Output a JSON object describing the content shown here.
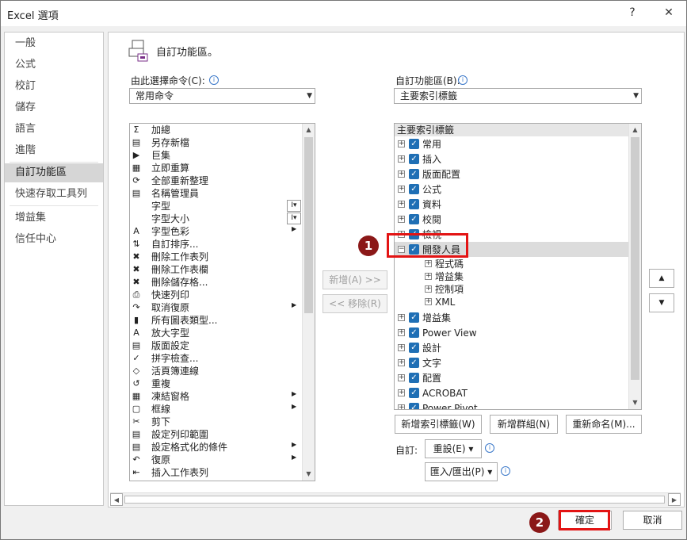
{
  "window": {
    "title": "Excel 選項",
    "help": "?",
    "close": "✕"
  },
  "nav": [
    {
      "label": "一般"
    },
    {
      "label": "公式"
    },
    {
      "label": "校訂"
    },
    {
      "label": "儲存"
    },
    {
      "label": "語言"
    },
    {
      "label": "進階"
    },
    {
      "label": "自訂功能區"
    },
    {
      "label": "快速存取工具列"
    },
    {
      "label": "增益集"
    },
    {
      "label": "信任中心"
    }
  ],
  "header": {
    "title": "自訂功能區。"
  },
  "left": {
    "label": "由此選擇命令(C):",
    "combo_value": "常用命令",
    "commands": [
      {
        "label": "加總",
        "icon": "Σ"
      },
      {
        "label": "另存新檔",
        "icon": "▤"
      },
      {
        "label": "巨集",
        "icon": "▶"
      },
      {
        "label": "立即重算",
        "icon": "▦"
      },
      {
        "label": "全部重新整理",
        "icon": "⟳"
      },
      {
        "label": "名稱管理員",
        "icon": "▤"
      },
      {
        "label": "字型",
        "icon": ""
      },
      {
        "label": "字型大小",
        "icon": ""
      },
      {
        "label": "字型色彩",
        "icon": "A"
      },
      {
        "label": "自訂排序...",
        "icon": "⇅"
      },
      {
        "label": "刪除工作表列",
        "icon": "✖"
      },
      {
        "label": "刪除工作表欄",
        "icon": "✖"
      },
      {
        "label": "刪除儲存格...",
        "icon": "✖"
      },
      {
        "label": "快速列印",
        "icon": "⎙"
      },
      {
        "label": "取消復原",
        "icon": "↷"
      },
      {
        "label": "所有圖表類型...",
        "icon": "▮"
      },
      {
        "label": "放大字型",
        "icon": "A"
      },
      {
        "label": "版面設定",
        "icon": "▤"
      },
      {
        "label": "拼字檢查...",
        "icon": "✓"
      },
      {
        "label": "活頁簿連線",
        "icon": "◇"
      },
      {
        "label": "重複",
        "icon": "↺"
      },
      {
        "label": "凍結窗格",
        "icon": "▦"
      },
      {
        "label": "框線",
        "icon": "▢"
      },
      {
        "label": "剪下",
        "icon": "✂"
      },
      {
        "label": "設定列印範圍",
        "icon": "▤"
      },
      {
        "label": "設定格式化的條件",
        "icon": "▤"
      },
      {
        "label": "復原",
        "icon": "↶"
      },
      {
        "label": "插入工作表列",
        "icon": "⇤"
      }
    ]
  },
  "mid": {
    "add": "新增(A) >>",
    "remove": "<< 移除(R)"
  },
  "right": {
    "label": "自訂功能區(B):",
    "combo_value": "主要索引標籤",
    "tree_header": "主要索引標籤",
    "tabs_before": [
      {
        "label": "常用"
      },
      {
        "label": "插入"
      },
      {
        "label": "版面配置"
      },
      {
        "label": "公式"
      },
      {
        "label": "資料"
      },
      {
        "label": "校閱"
      },
      {
        "label": "檢視"
      }
    ],
    "developer": {
      "label": "開發人員",
      "children": [
        {
          "label": "程式碼"
        },
        {
          "label": "增益集"
        },
        {
          "label": "控制項"
        },
        {
          "label": "XML"
        }
      ]
    },
    "tabs_after": [
      {
        "label": "增益集"
      },
      {
        "label": "Power View"
      },
      {
        "label": "設計"
      },
      {
        "label": "文字"
      },
      {
        "label": "配置"
      },
      {
        "label": "ACROBAT"
      },
      {
        "label": "Power Pivot"
      }
    ],
    "new_tab": "新增索引標籤(W)",
    "new_group": "新增群組(N)",
    "rename": "重新命名(M)...",
    "custom_label": "自訂:",
    "reset": "重設(E) ▾",
    "import_export": "匯入/匯出(P) ▾"
  },
  "footer": {
    "ok": "確定",
    "cancel": "取消"
  },
  "annotations": {
    "badge1": "1",
    "badge2": "2"
  },
  "colors": {
    "checkbox": "#1f6fb5",
    "callout": "#e31414",
    "badge": "#8b1818"
  }
}
